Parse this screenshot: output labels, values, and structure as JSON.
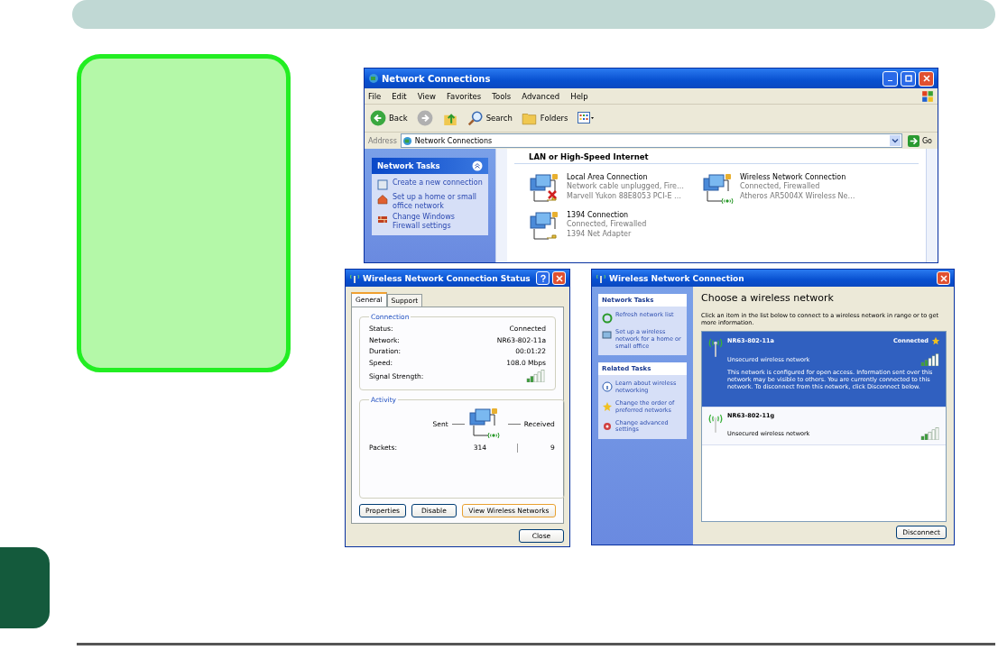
{
  "network_connections": {
    "title": "Network Connections",
    "menu": [
      "File",
      "Edit",
      "View",
      "Favorites",
      "Tools",
      "Advanced",
      "Help"
    ],
    "toolbar": [
      {
        "kind": "back",
        "label": "Back"
      },
      {
        "kind": "forward"
      },
      {
        "kind": "up"
      },
      {
        "kind": "search",
        "label": "Search"
      },
      {
        "kind": "folders",
        "label": "Folders"
      },
      {
        "kind": "views"
      }
    ],
    "address_label": "Address",
    "address": "Network Connections",
    "go": "Go",
    "task_panel": {
      "title": "Network Tasks",
      "items": [
        {
          "kind": "new",
          "label": "Create a new connection"
        },
        {
          "kind": "home",
          "label": "Set up a home or small office network"
        },
        {
          "kind": "firewall",
          "label": "Change Windows Firewall settings"
        }
      ]
    },
    "group_heading": "LAN or High-Speed Internet",
    "connections": [
      {
        "kind": "wired",
        "name": "Local Area Connection",
        "status": "Network cable unplugged, Fire…",
        "device": "Marvell Yukon 88E8053 PCI-E …",
        "disconnected": true
      },
      {
        "kind": "wireless",
        "name": "Wireless Network Connection",
        "status": "Connected, Firewalled",
        "device": "Atheros AR5004X Wireless Ne…",
        "disconnected": false
      },
      {
        "kind": "wired",
        "name": "1394 Connection",
        "status": "Connected, Firewalled",
        "device": "1394 Net Adapter",
        "disconnected": false
      }
    ]
  },
  "status_dialog": {
    "title": "Wireless Network Connection Status",
    "tabs": [
      {
        "label": "General",
        "selected": true
      },
      {
        "label": "Support",
        "selected": false
      }
    ],
    "connection_legend": "Connection",
    "rows": [
      {
        "label": "Status:",
        "value": "Connected"
      },
      {
        "label": "Network:",
        "value": "NR63-802-11a"
      },
      {
        "label": "Duration:",
        "value": "00:01:22"
      },
      {
        "label": "Speed:",
        "value": "108.0 Mbps"
      }
    ],
    "signal_label": "Signal Strength:",
    "activity_legend": "Activity",
    "sent_label": "Sent",
    "received_label": "Received",
    "packets_label": "Packets:",
    "packets_sent": "314",
    "packets_received": "9",
    "buttons": [
      "Properties",
      "Disable",
      "View Wireless Networks"
    ],
    "close": "Close"
  },
  "wireless_dialog": {
    "title": "Wireless Network Connection",
    "panels": [
      {
        "title": "Network Tasks",
        "items": [
          {
            "kind": "refresh",
            "label": "Refresh network list"
          },
          {
            "kind": "setup",
            "label": "Set up a wireless network for a home or small office"
          }
        ]
      },
      {
        "title": "Related Tasks",
        "items": [
          {
            "kind": "learn",
            "label": "Learn about wireless networking"
          },
          {
            "kind": "order",
            "label": "Change the order of preferred networks"
          },
          {
            "kind": "advanced",
            "label": "Change advanced settings"
          }
        ]
      }
    ],
    "heading": "Choose a wireless network",
    "intro": "Click an item in the list below to connect to a wireless network in range or to get more information.",
    "networks": [
      {
        "name": "NR63-802-11a",
        "security": "Unsecured wireless network",
        "status": "Connected",
        "selected": true,
        "description": "This network is configured for open access. Information sent over this network may be visible to others. You are currently connected to this network. To disconnect from this network, click Disconnect below."
      },
      {
        "name": "NR63-802-11g",
        "security": "Unsecured wireless network",
        "selected": false
      }
    ],
    "button": "Disconnect"
  }
}
